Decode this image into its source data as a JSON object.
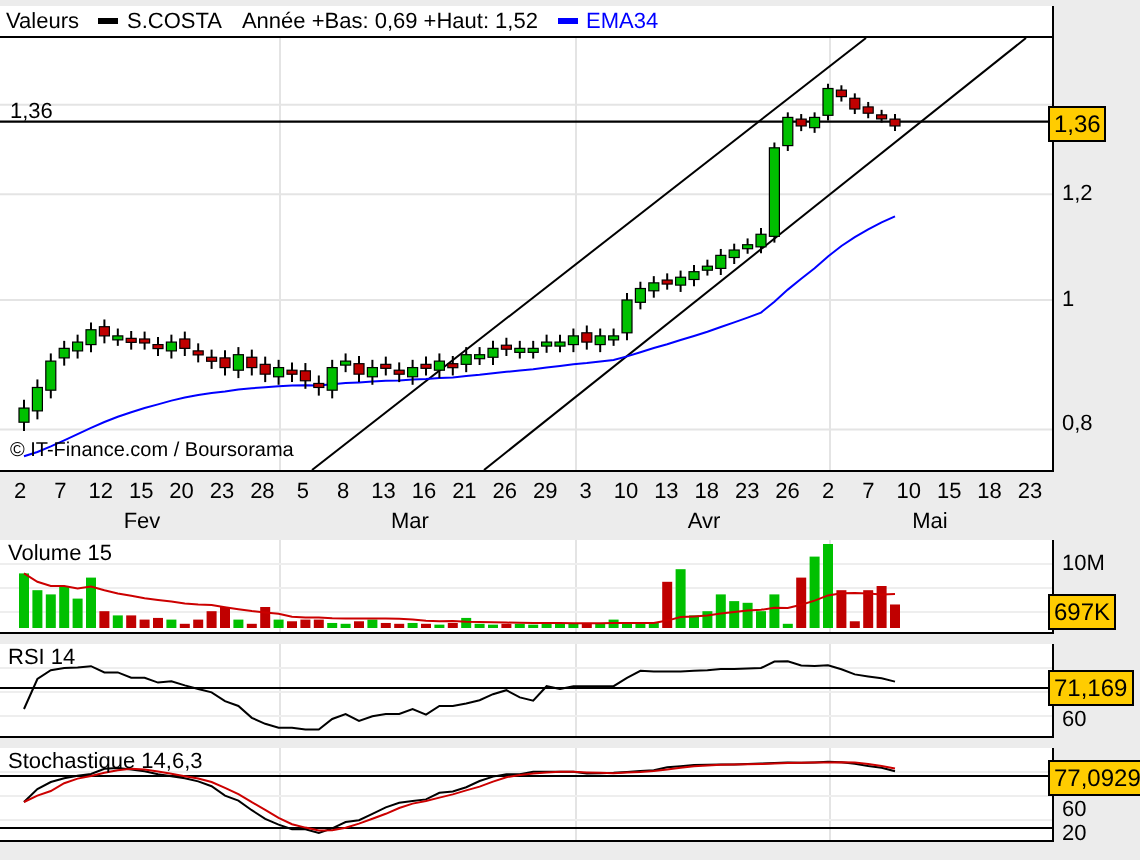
{
  "header": [
    {
      "kind": "text",
      "text": "Valeurs"
    },
    {
      "kind": "legend",
      "text": "S.COSTA",
      "color": "#000000"
    },
    {
      "kind": "text",
      "text": "Année +Bas: 0,69 +Haut: 1,52"
    },
    {
      "kind": "legend",
      "text": "EMA34",
      "color": "#0000ff"
    }
  ],
  "price_panel": {
    "level_label": "1,36",
    "credit": "© IT-Finance.com / Boursorama",
    "y_labels": [
      "1,2",
      "1",
      "0,8"
    ],
    "last_badge": "1,36"
  },
  "date_axis": {
    "days": [
      "2",
      "7",
      "12",
      "15",
      "20",
      "23",
      "28",
      "5",
      "8",
      "13",
      "16",
      "21",
      "26",
      "29",
      "3",
      "10",
      "13",
      "18",
      "23",
      "26",
      "2",
      "7",
      "10",
      "15",
      "18",
      "23"
    ],
    "months": [
      "Fev",
      "Mar",
      "Avr",
      "Mai"
    ]
  },
  "indicators": [
    {
      "kind": "volume",
      "title": "Volume 15",
      "y_labels": [
        "10M"
      ],
      "badge": "697K"
    },
    {
      "kind": "rsi",
      "title": "RSI 14",
      "y_labels": [
        "60"
      ],
      "badge": "71,169"
    },
    {
      "kind": "stoch",
      "title": "Stochastique 14,6,3",
      "y_labels": [
        "60",
        "20"
      ],
      "badge": "77,0929"
    }
  ]
}
